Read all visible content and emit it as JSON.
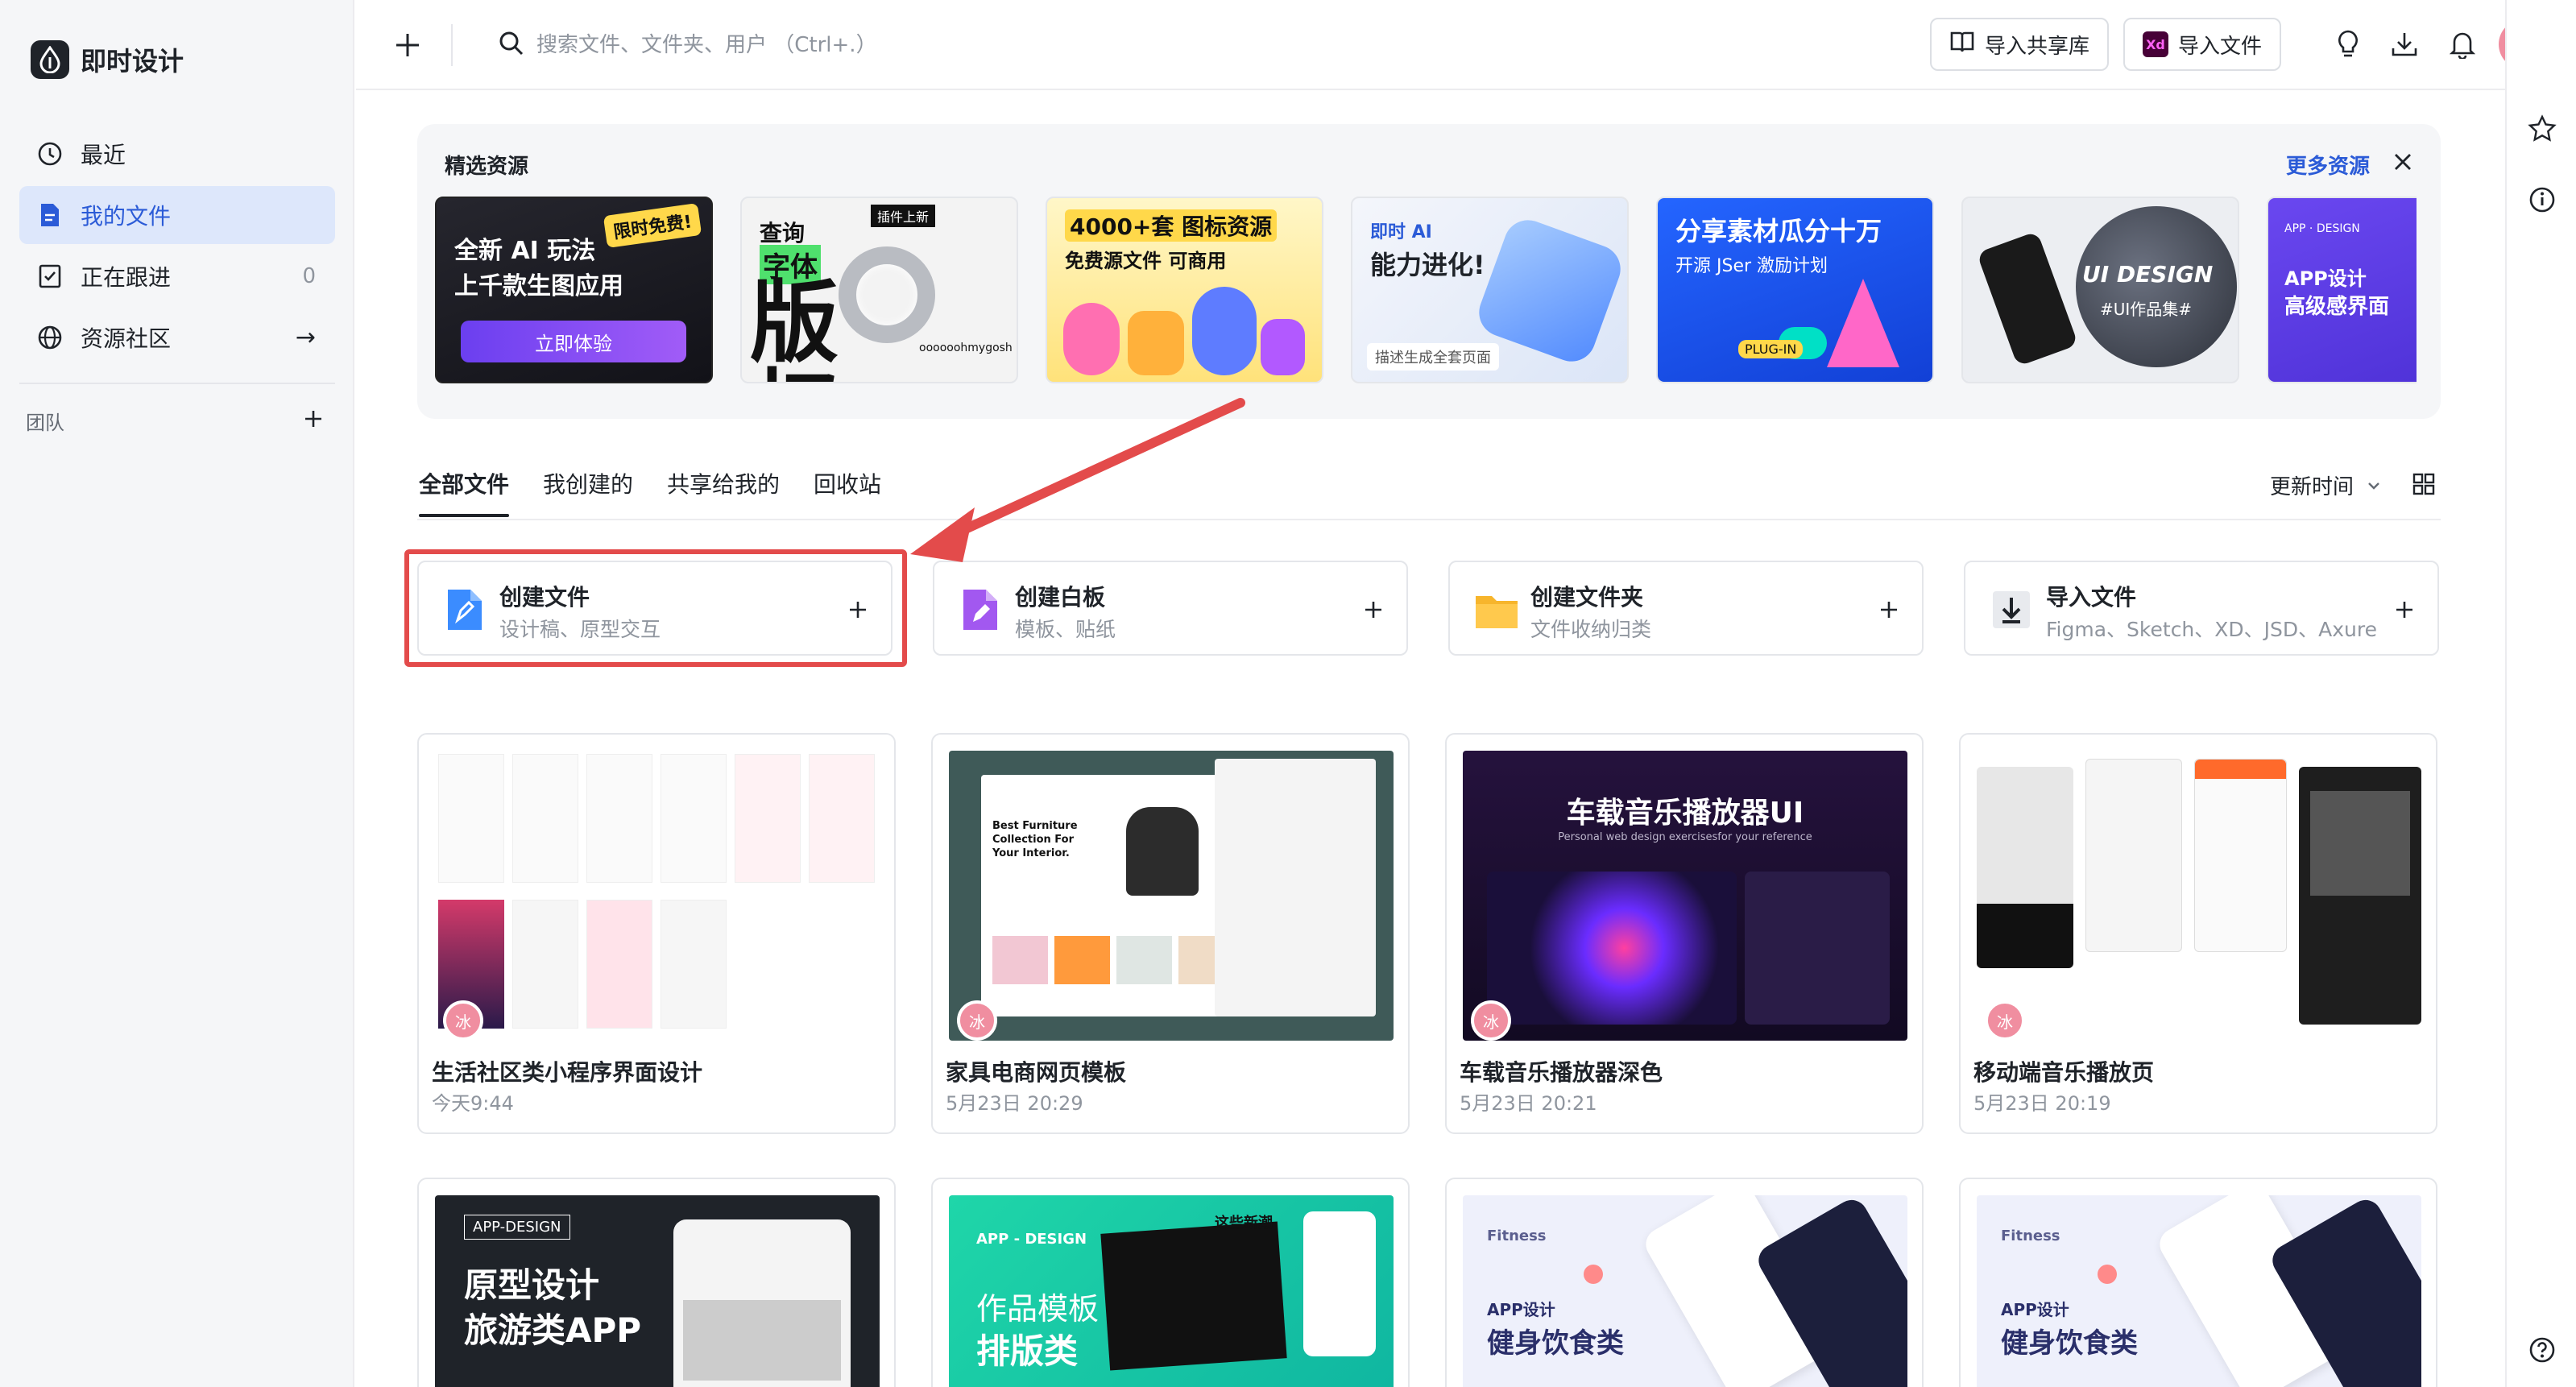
{
  "app": {
    "name": "即时设计",
    "avatar_initial": "冰"
  },
  "sidebar": {
    "items": [
      {
        "label": "最近",
        "trail": ""
      },
      {
        "label": "我的文件",
        "trail": ""
      },
      {
        "label": "正在跟进",
        "trail": "0"
      },
      {
        "label": "资源社区",
        "trail": "→"
      }
    ],
    "team_label": "团队"
  },
  "topbar": {
    "search_placeholder": "搜索文件、文件夹、用户 （Ctrl+.）",
    "import_library": "导入共享库",
    "import_file": "导入文件",
    "xd_badge": "Xd"
  },
  "featured": {
    "title": "精选资源",
    "more": "更多资源",
    "banners": [
      {
        "line1": "全新 AI 玩法",
        "line2": "上千款生图应用",
        "cta": "立即体验",
        "tag": "限时免费!",
        "colors": [
          "#1b1b22",
          "#7a4cf2"
        ]
      },
      {
        "line1": "查询",
        "line2": "字体",
        "big": "版权",
        "tag": "插件上新",
        "small": "oooooohmygosh",
        "colors": [
          "#f4f4f4",
          "#111"
        ]
      },
      {
        "line1": "4000+套 图标资源",
        "line2": "免费源文件  可商用",
        "colors": [
          "#fdf1a8",
          "#ffd84a"
        ]
      },
      {
        "line1": "即时 AI",
        "line2": "能力进化!",
        "small": "描述生成全套页面",
        "colors": [
          "#e9edf7",
          "#5ea1ff"
        ]
      },
      {
        "line1": "分享素材瓜分十万",
        "line2": "开源 JSer 激励计划",
        "tag": "PLUG-IN",
        "colors": [
          "#1e5bff",
          "#1342d9"
        ]
      },
      {
        "line1": "UI DESIGN",
        "line2": "#UI作品集#",
        "colors": [
          "#e9ebef",
          "#3a3f4a"
        ]
      },
      {
        "line1": "APP设计",
        "line2": "高级感界面",
        "small": "APP · DESIGN",
        "colors": [
          "#5a3de6",
          "#7b55f5"
        ]
      }
    ]
  },
  "tabs": [
    "全部文件",
    "我创建的",
    "共享给我的",
    "回收站"
  ],
  "sort": {
    "label": "更新时间"
  },
  "actions": [
    {
      "title": "创建文件",
      "sub": "设计稿、原型交互",
      "color": "#3b8cff"
    },
    {
      "title": "创建白板",
      "sub": "模板、贴纸",
      "color": "#a258f0"
    },
    {
      "title": "创建文件夹",
      "sub": "文件收纳归类",
      "color": "#f7b52c"
    },
    {
      "title": "导入文件",
      "sub": "Figma、Sketch、XD、JSD、Axure",
      "color": "#555b66"
    }
  ],
  "files": [
    {
      "name": "生活社区类小程序界面设计",
      "time": "今天9:44",
      "thumb_title": "",
      "bg": "#ffffff"
    },
    {
      "name": "家具电商网页模板",
      "time": "5月23日 20:29",
      "thumb_title": "Best Furniture Collection For Your Interior.",
      "bg": "#3f5a58"
    },
    {
      "name": "车载音乐播放器深色",
      "time": "5月23日 20:21",
      "thumb_title": "车载音乐播放器UI",
      "thumb_sub": "Personal web design exercisesfor your reference",
      "bg": "#1c1030"
    },
    {
      "name": "移动端音乐播放页",
      "time": "5月23日 20:19",
      "thumb_title": "",
      "bg": "#f2f2f2"
    }
  ],
  "files_row2": [
    {
      "tag": "APP-DESIGN",
      "line1": "原型设计",
      "line2": "旅游类APP",
      "bg": "#1f2329"
    },
    {
      "tag": "APP - DESIGN",
      "line1": "作品模板",
      "line2": "排版类",
      "extra": "这些新潮",
      "bg": "#17c7a3"
    },
    {
      "tag": "Fitness",
      "line1": "APP设计",
      "line2": "健身饮食类",
      "bg": "#eef0fb"
    },
    {
      "tag": "Fitness",
      "line1": "APP设计",
      "line2": "健身饮食类",
      "bg": "#eef0fb"
    }
  ]
}
